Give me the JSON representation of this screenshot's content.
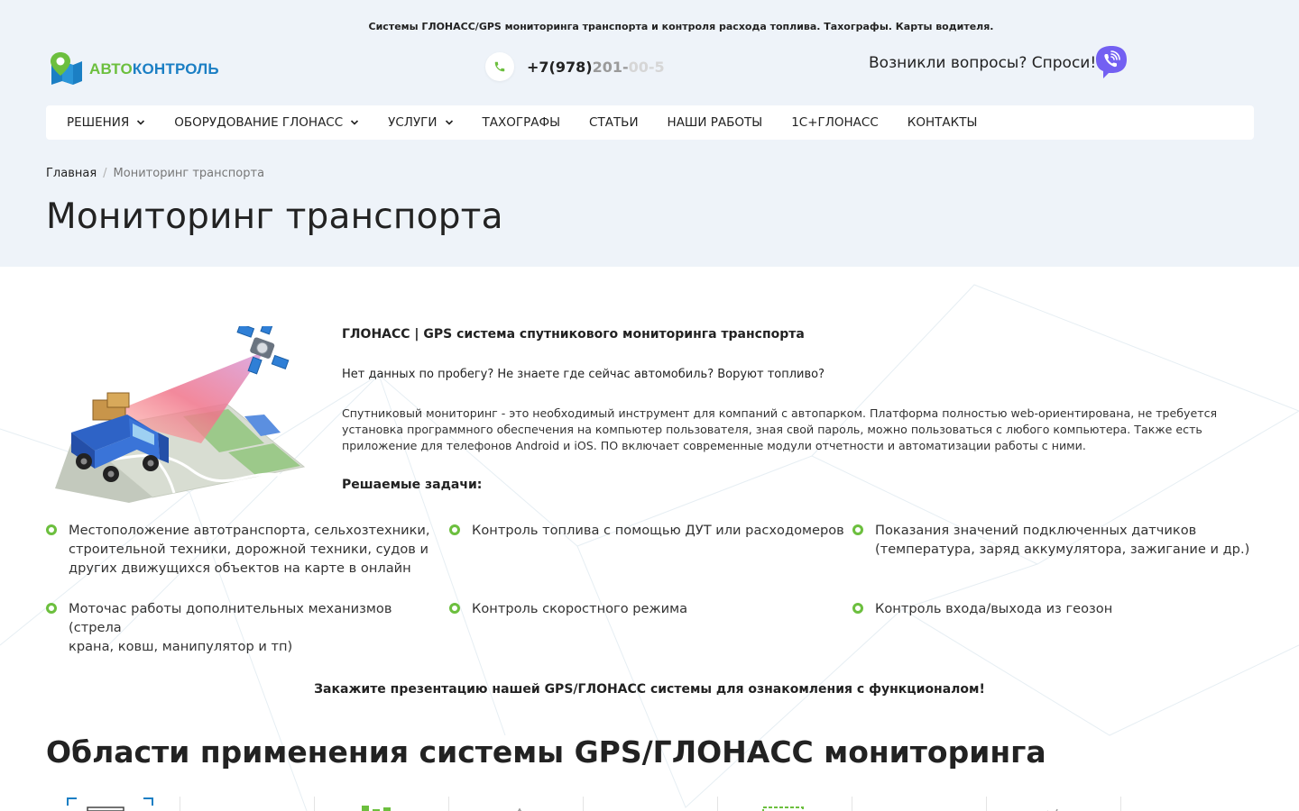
{
  "header": {
    "tagline": "Системы ГЛОНАСС/GPS мониторинга транспорта и контроля расхода топлива. Тахографы. Карты водителя.",
    "logo": {
      "part1": "АВТО",
      "part2": "КОНТРОЛЬ"
    },
    "phone": {
      "main": "+7(978)",
      "fade1": "201-",
      "fade2": "00-5"
    },
    "ask": "Возникли вопросы? Спроси!",
    "colors": {
      "green": "#6cbf3e",
      "blue": "#1b7fc4",
      "viber": "#7360f2"
    }
  },
  "nav": {
    "items": [
      {
        "label": "РЕШЕНИЯ",
        "dropdown": true
      },
      {
        "label": "ОБОРУДОВАНИЕ ГЛОНАСС",
        "dropdown": true
      },
      {
        "label": "УСЛУГИ",
        "dropdown": true
      },
      {
        "label": "ТАХОГРАФЫ",
        "dropdown": false
      },
      {
        "label": "СТАТЬИ",
        "dropdown": false
      },
      {
        "label": "НАШИ РАБОТЫ",
        "dropdown": false
      },
      {
        "label": "1С+ГЛОНАСС",
        "dropdown": false
      },
      {
        "label": "КОНТАКТЫ",
        "dropdown": false
      }
    ]
  },
  "breadcrumb": {
    "home": "Главная",
    "sep": "/",
    "current": "Мониторинг транспорта"
  },
  "page_title": "Мониторинг транспорта",
  "intro": {
    "heading": "ГЛОНАСС | GPS система спутникового мониторинга транспорта",
    "question": "Нет данных по пробегу? Не знаете где сейчас автомобиль? Воруют топливо?",
    "paragraph_lines": [
      "Спутниковый мониторинг - это необходимый инструмент для компаний с автопарком. Платформа полностью web-ориентирована, не требуется",
      "установка программного обеспечения на компьютер пользователя, зная свой пароль, можно пользоваться с любого компьютера. Также есть",
      "приложение для телефонов Android и iOS. ПО включает современные модули отчетности и автоматизации работы с ними."
    ],
    "tasks_title": "Решаемые задачи:"
  },
  "tasks": [
    {
      "lines": [
        "Местоположение автотранспорта, сельхозтехники,",
        "строительной техники, дорожной техники, судов и",
        "других движущихся объектов на карте в онлайн"
      ]
    },
    {
      "lines": [
        "Контроль топлива с помощью ДУТ или расходомеров"
      ]
    },
    {
      "lines": [
        "Показания значений подключенных датчиков",
        "(температура, заряд аккумулятора, зажигание и др.)"
      ]
    },
    {
      "lines": [
        "Моточас работы дополнительных механизмов (стрела",
        "крана, ковш, манипулятор и тп)"
      ]
    },
    {
      "lines": [
        "Контроль скоростного режима"
      ]
    },
    {
      "lines": [
        "Контроль входа/выхода из геозон"
      ]
    }
  ],
  "cta": "Закажите презентацию нашей GPS/ГЛОНАСС системы для ознакомления с функционалом!",
  "section_title": "Области применения системы GPS/ГЛОНАСС мониторинга"
}
